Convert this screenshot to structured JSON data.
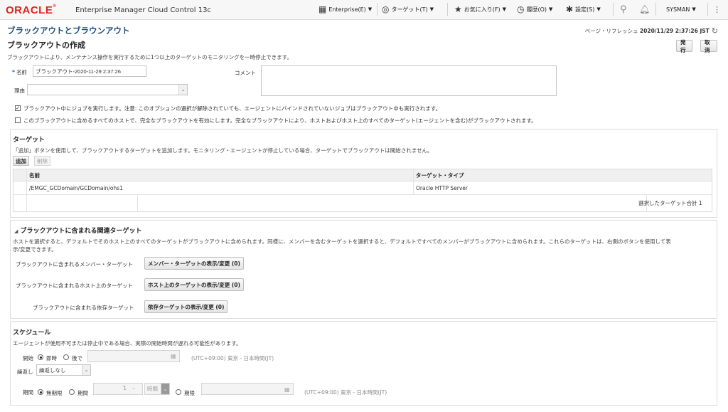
{
  "header": {
    "logo": "ORACLE",
    "product": "Enterprise Manager",
    "product_suffix": "Cloud Control 13c",
    "menus": {
      "enterprise": "Enterprise(E)",
      "target": "ターゲット(T)",
      "favorites": "お気に入り(F)",
      "history": "履歴(O)",
      "settings": "設定(S)",
      "user": "SYSMAN"
    }
  },
  "page": {
    "title": "ブラックアウトとブラウンアウト",
    "refresh_label": "ページ・リフレッシュ",
    "refresh_time": "2020/11/29 2:37:26 JST",
    "subtitle": "ブラックアウトの作成",
    "description": "ブラックアウトにより、メンテナンス操作を実行するために1つ以上のターゲットのモニタリングを一時停止できます。",
    "submit_label": "発行",
    "cancel_label": "取消"
  },
  "form": {
    "name_label": "名前",
    "name_value": "ブラックアウト-2020-11-29 2:37:26",
    "comment_label": "コメント",
    "reason_label": "理由",
    "reason_value": "",
    "run_jobs_checked": true,
    "run_jobs_label": "ブラックアウト中にジョブを実行します。注意: このオプションの選択が解除されていても、エージェントにバインドされていないジョブはブラックアウト中も実行されます。",
    "full_blackout_checked": false,
    "full_blackout_label": "このブラックアウトに含めるすべてのホストで、完全なブラックアウトを有効にします。完全なブラックアウトにより、ホストおよびホスト上のすべてのターゲット(エージェントを含む)がブラックアウトされます。"
  },
  "targets": {
    "title": "ターゲット",
    "description": "「追加」ボタンを使用して、ブラックアウトするターゲットを追加します。モニタリング・エージェントが停止している場合、ターゲットでブラックアウトは開始されません。",
    "add_label": "追加",
    "remove_label": "削除",
    "columns": [
      "名前",
      "ターゲット・タイプ"
    ],
    "rows": [
      {
        "name": "/EMGC_GCDomain/GCDomain/ohs1",
        "type": "Oracle HTTP Server"
      }
    ],
    "total_label": "選択したターゲット合計",
    "total_value": "1"
  },
  "related": {
    "title": "ブラックアウトに含まれる関連ターゲット",
    "description_1": "ホストを選択すると、デフォルトでそのホスト上のすべてのターゲットがブラックアウトに含められます。同様に、メンバーを含むターゲットを選択すると、デフォルトですべてのメンバーがブラックアウトに含められます。これらのターゲットは、右側のボタンを使用して表",
    "description_2": "示/変更できます。",
    "member_label": "ブラックアウトに含まれるメンバー・ターゲット",
    "member_button": "メンバー・ターゲットの表示/変更 (0)",
    "host_label": "ブラックアウトに含まれるホスト上のターゲット",
    "host_button": "ホスト上のターゲットの表示/変更 (0)",
    "dep_label": "ブラックアウトに含まれる依存ターゲット",
    "dep_button": "依存ターゲットの表示/変更 (0)"
  },
  "schedule": {
    "title": "スケジュール",
    "description": "エージェントが使用不可または停止中である場合、実際の開始時間が遅れる可能性があります。",
    "start_label": "開始",
    "start_now": "即時",
    "start_later": "後で",
    "start_selected": "即時",
    "timezone": "(UTC+09:00) 東京 - 日本時間(JT)",
    "repeat_label": "繰返し",
    "repeat_value": "繰返しなし",
    "duration_label": "期間",
    "duration_indef": "無期限",
    "duration_period": "期間",
    "duration_value": "1",
    "duration_unit": "時間",
    "duration_end": "期限",
    "duration_selected": "無期限",
    "timezone2": "(UTC+09:00) 東京 - 日本時間(JT)"
  }
}
